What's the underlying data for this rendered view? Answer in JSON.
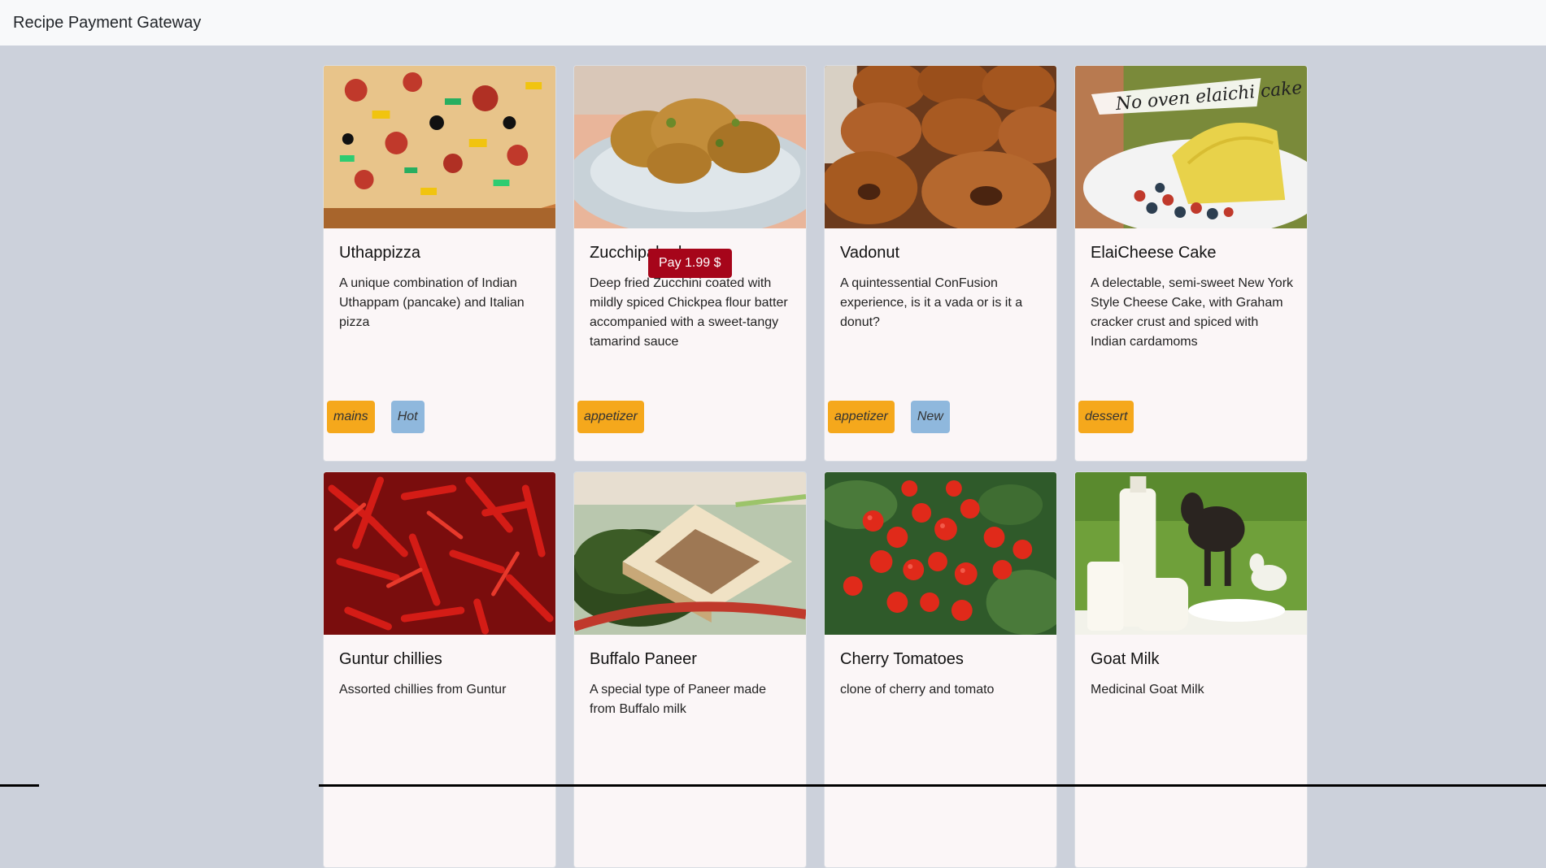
{
  "navbar": {
    "brand": "Recipe Payment Gateway"
  },
  "pay_button": {
    "label": "Pay 1.99 $"
  },
  "cards": [
    {
      "title": "Uthappizza",
      "description": "A unique combination of Indian Uthappam (pancake) and Italian pizza",
      "category": "mains",
      "label": "Hot"
    },
    {
      "title": "Zucchipakoda",
      "description": "Deep fried Zucchini coated with mildly spiced Chickpea flour batter accompanied with a sweet-tangy tamarind sauce",
      "category": "appetizer",
      "label": ""
    },
    {
      "title": "Vadonut",
      "description": "A quintessential ConFusion experience, is it a vada or is it a donut?",
      "category": "appetizer",
      "label": "New"
    },
    {
      "title": "ElaiCheese Cake",
      "description": "A delectable, semi-sweet New York Style Cheese Cake, with Graham cracker crust and spiced with Indian cardamoms",
      "category": "dessert",
      "label": "",
      "image_text": "No oven elaichi cake"
    },
    {
      "title": "Guntur chillies",
      "description": "Assorted chillies from Guntur",
      "category": "",
      "label": ""
    },
    {
      "title": "Buffalo Paneer",
      "description": "A special type of Paneer made from Buffalo milk",
      "category": "",
      "label": ""
    },
    {
      "title": "Cherry Tomatoes",
      "description": "clone of cherry and tomato",
      "category": "",
      "label": ""
    },
    {
      "title": "Goat Milk",
      "description": "Medicinal Goat Milk",
      "category": "",
      "label": ""
    }
  ]
}
